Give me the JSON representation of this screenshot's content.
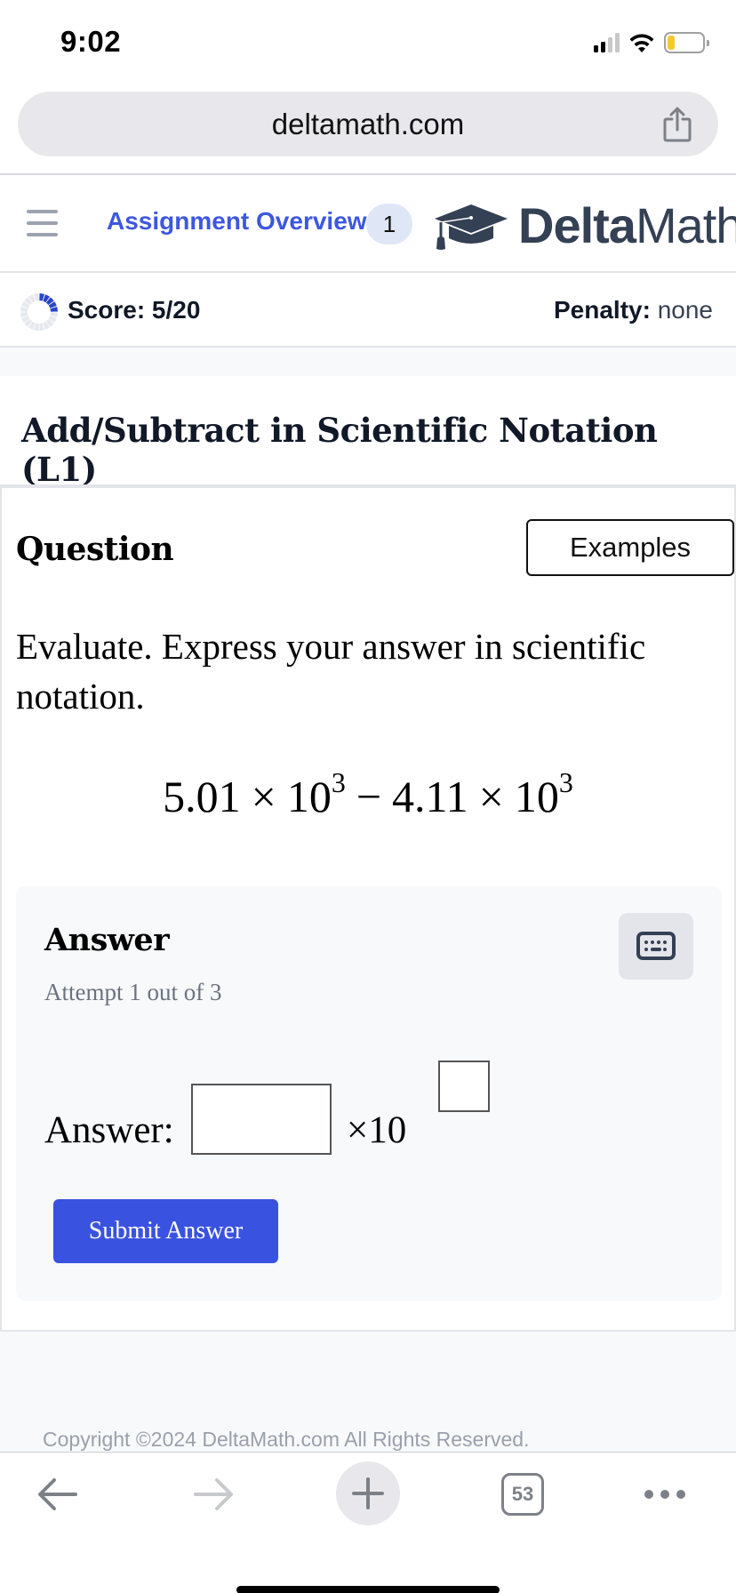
{
  "status_bar": {
    "time": "9:02",
    "signal_bars_filled": 2,
    "signal_bars_total": 4,
    "battery_level_percent": 20,
    "battery_color": "#f5c82e"
  },
  "browser": {
    "url": "deltamath.com",
    "share_icon": "share-icon",
    "toolbar": {
      "back_icon": "arrow-left-icon",
      "forward_icon": "arrow-right-icon",
      "new_tab_icon": "plus-icon",
      "tab_count": "53",
      "more_icon": "ellipsis-icon"
    }
  },
  "header": {
    "menu_icon": "hamburger-icon",
    "assignment_link": "Assignment Overview",
    "badge_count": "1",
    "logo": {
      "bold": "Delta",
      "regular": "Math",
      "icon": "graduation-cap-icon"
    },
    "link_color": "#3d57e0"
  },
  "score": {
    "label": "Score: 5/20",
    "earned": 5,
    "total": 20,
    "ring_fill_color": "#2a44c8",
    "ring_empty_color": "#e6e8ee",
    "penalty_label": "Penalty:",
    "penalty_value": "none"
  },
  "skill": {
    "title": "Add/Subtract in Scientific Notation (L1)"
  },
  "question": {
    "label": "Question",
    "examples_button": "Examples",
    "prompt": "Evaluate. Express your answer in scientific notation.",
    "expression": {
      "a_coefficient": "5.01",
      "a_base": "10",
      "a_exponent": "3",
      "operator": "−",
      "b_coefficient": "4.11",
      "b_base": "10",
      "b_exponent": "3",
      "times": "×"
    }
  },
  "answer": {
    "heading": "Answer",
    "attempt_text": "Attempt 1 out of 3",
    "keyboard_icon": "keyboard-icon",
    "input_label": "Answer:",
    "mantissa_value": "",
    "times_ten": "×10",
    "exponent_value": "",
    "submit_button": "Submit Answer",
    "submit_color": "#3a52e0"
  },
  "footer": {
    "copyright": "Copyright ©2024 DeltaMath.com All Rights Reserved."
  }
}
